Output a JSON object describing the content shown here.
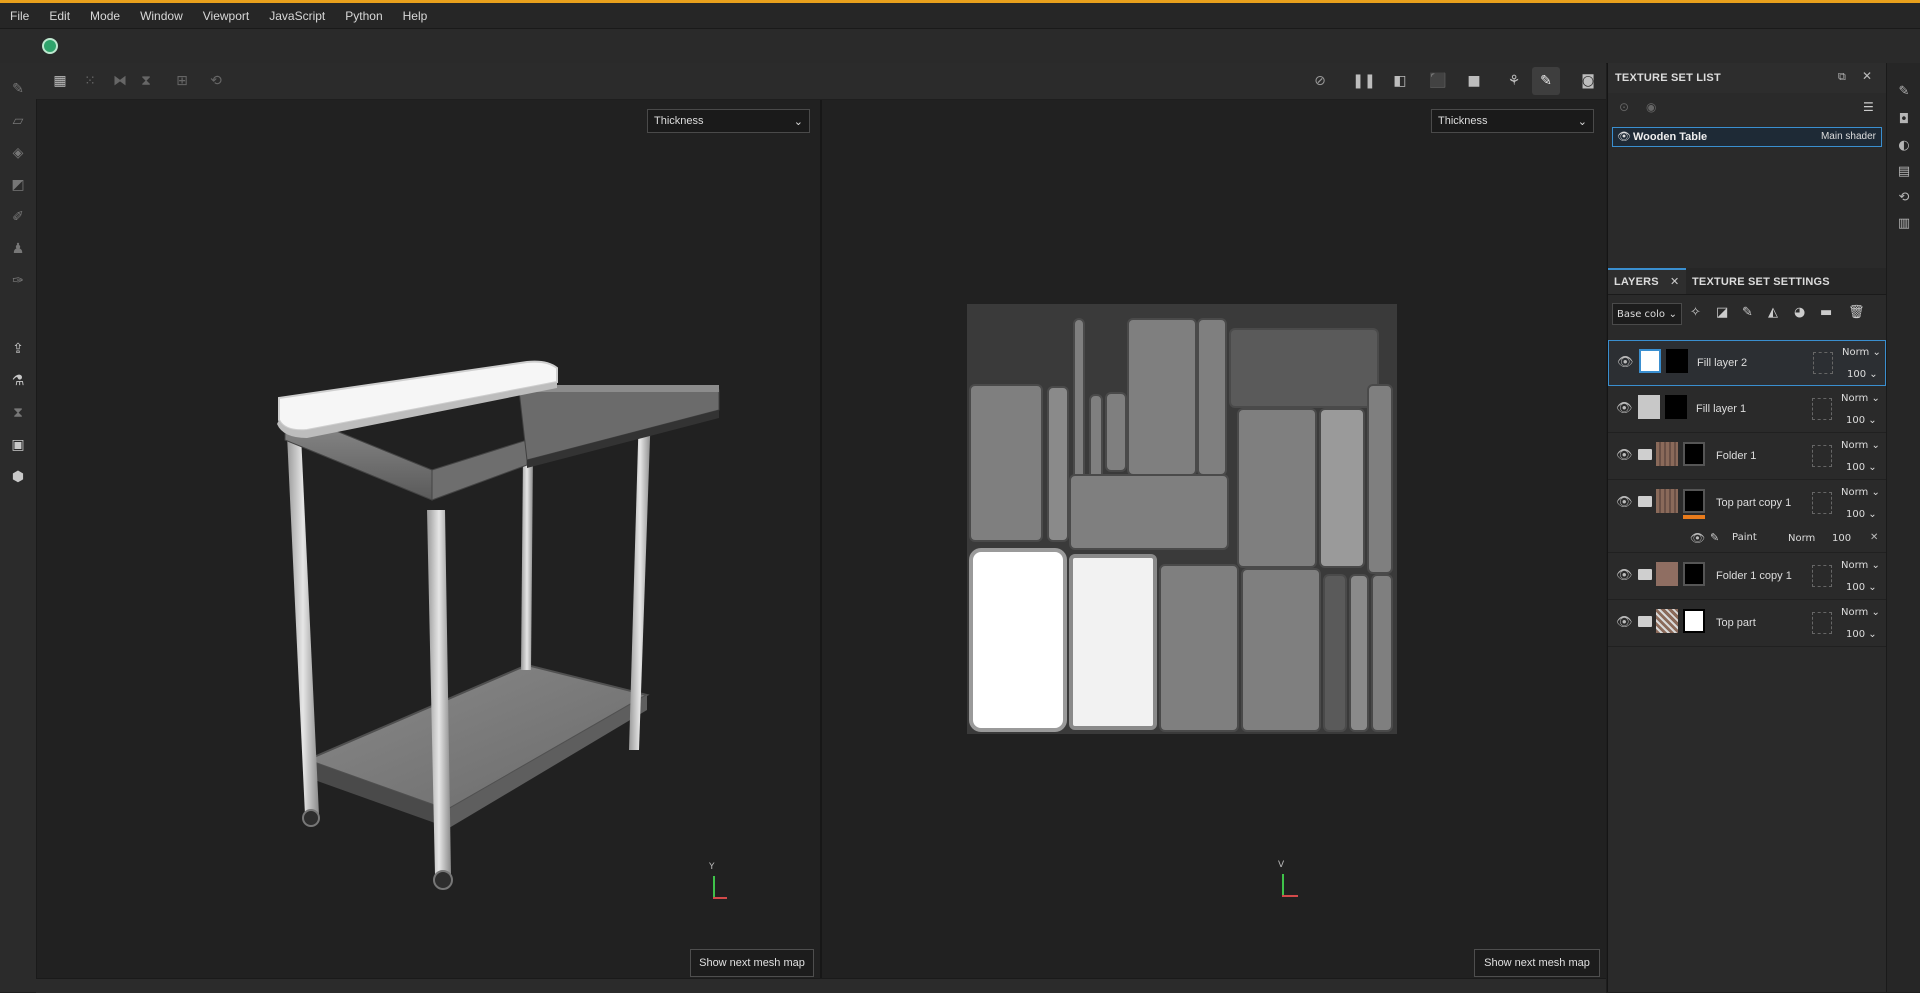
{
  "menu": [
    "File",
    "Edit",
    "Mode",
    "Window",
    "Viewport",
    "JavaScript",
    "Python",
    "Help"
  ],
  "viewport3d": {
    "channel": "Thickness",
    "mesh_button": "Show next mesh map",
    "axis_label": "Y"
  },
  "viewport2d": {
    "channel": "Thickness",
    "mesh_button": "Show next mesh map",
    "axis_label": "V"
  },
  "texture_set_list": {
    "title": "TEXTURE SET LIST",
    "item_name": "Wooden Table",
    "item_shader": "Main shader"
  },
  "tabs": {
    "layers": "LAYERS",
    "texture_set_settings": "TEXTURE SET SETTINGS"
  },
  "channel_select": "Base colo",
  "layers": [
    {
      "name": "Fill layer 2",
      "blend": "Norm",
      "opacity": "100"
    },
    {
      "name": "Fill layer 1",
      "blend": "Norm",
      "opacity": "100"
    },
    {
      "name": "Folder 1",
      "blend": "Norm",
      "opacity": "100"
    },
    {
      "name": "Top part copy 1",
      "blend": "Norm",
      "opacity": "100"
    },
    {
      "name": "Folder 1 copy 1",
      "blend": "Norm",
      "opacity": "100"
    },
    {
      "name": "Top part",
      "blend": "Norm",
      "opacity": "100"
    }
  ],
  "sublayer": {
    "name": "Paint",
    "blend": "Norm",
    "opacity": "100"
  },
  "colors": {
    "accent": "#e8a01c",
    "selection": "#3a8fd0"
  }
}
